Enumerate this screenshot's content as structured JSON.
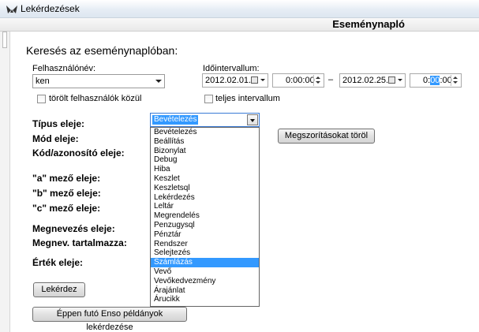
{
  "window": {
    "title": "Lekérdezések",
    "app_icon": "arrows-app-icon"
  },
  "page": {
    "title": "Eseménynapló"
  },
  "section": {
    "title": "Keresés az eseménynaplóban:"
  },
  "user": {
    "label": "Felhasználónév:",
    "value": "ken",
    "deleted_users_label": "törölt felhasználók közül",
    "deleted_users_checked": false
  },
  "interval": {
    "label": "Időintervallum:",
    "start_date": "2012.02.01.",
    "start_time_before": "0:00",
    "start_time_after": ":00",
    "separator": "–",
    "end_date": "2012.02.25.",
    "end_time_before": "0:",
    "end_time_selected": "00",
    "end_time_after": ":00",
    "full_interval_label": "teljes intervallum",
    "full_interval_checked": false
  },
  "filters": {
    "type_label": "Típus eleje:",
    "mode_label": "Mód eleje:",
    "code_label": "Kód/azonosító eleje:",
    "a_label": "\"a\" mező eleje:",
    "b_label": "\"b\" mező eleje:",
    "c_label": "\"c\" mező eleje:",
    "name_label": "Megnevezés eleje:",
    "name_contains_label": "Megnev. tartalmazza:",
    "value_label": "Érték eleje:"
  },
  "type_combo": {
    "selected": "Bevételezés",
    "options": [
      "Bevételezés",
      "Beállítás",
      "Bizonylat",
      "Debug",
      "Hiba",
      "Keszlet",
      "Keszletsql",
      "Lekérdezés",
      "Leltár",
      "Megrendelés",
      "Penzugysql",
      "Pénztár",
      "Rendszer",
      "Selejtezés",
      "Számlázás",
      "Vevő",
      "Vevőkedvezmény",
      "Árajánlat",
      "Árucikk"
    ],
    "highlighted_index": 14
  },
  "buttons": {
    "clear_filters": "Megszorításokat töröl",
    "query": "Lekérdez",
    "running_instances": "Éppen futó Enso példányok lekérdezése"
  },
  "colors": {
    "selection": "#3399ff",
    "titlebar": "#dde6f0"
  }
}
